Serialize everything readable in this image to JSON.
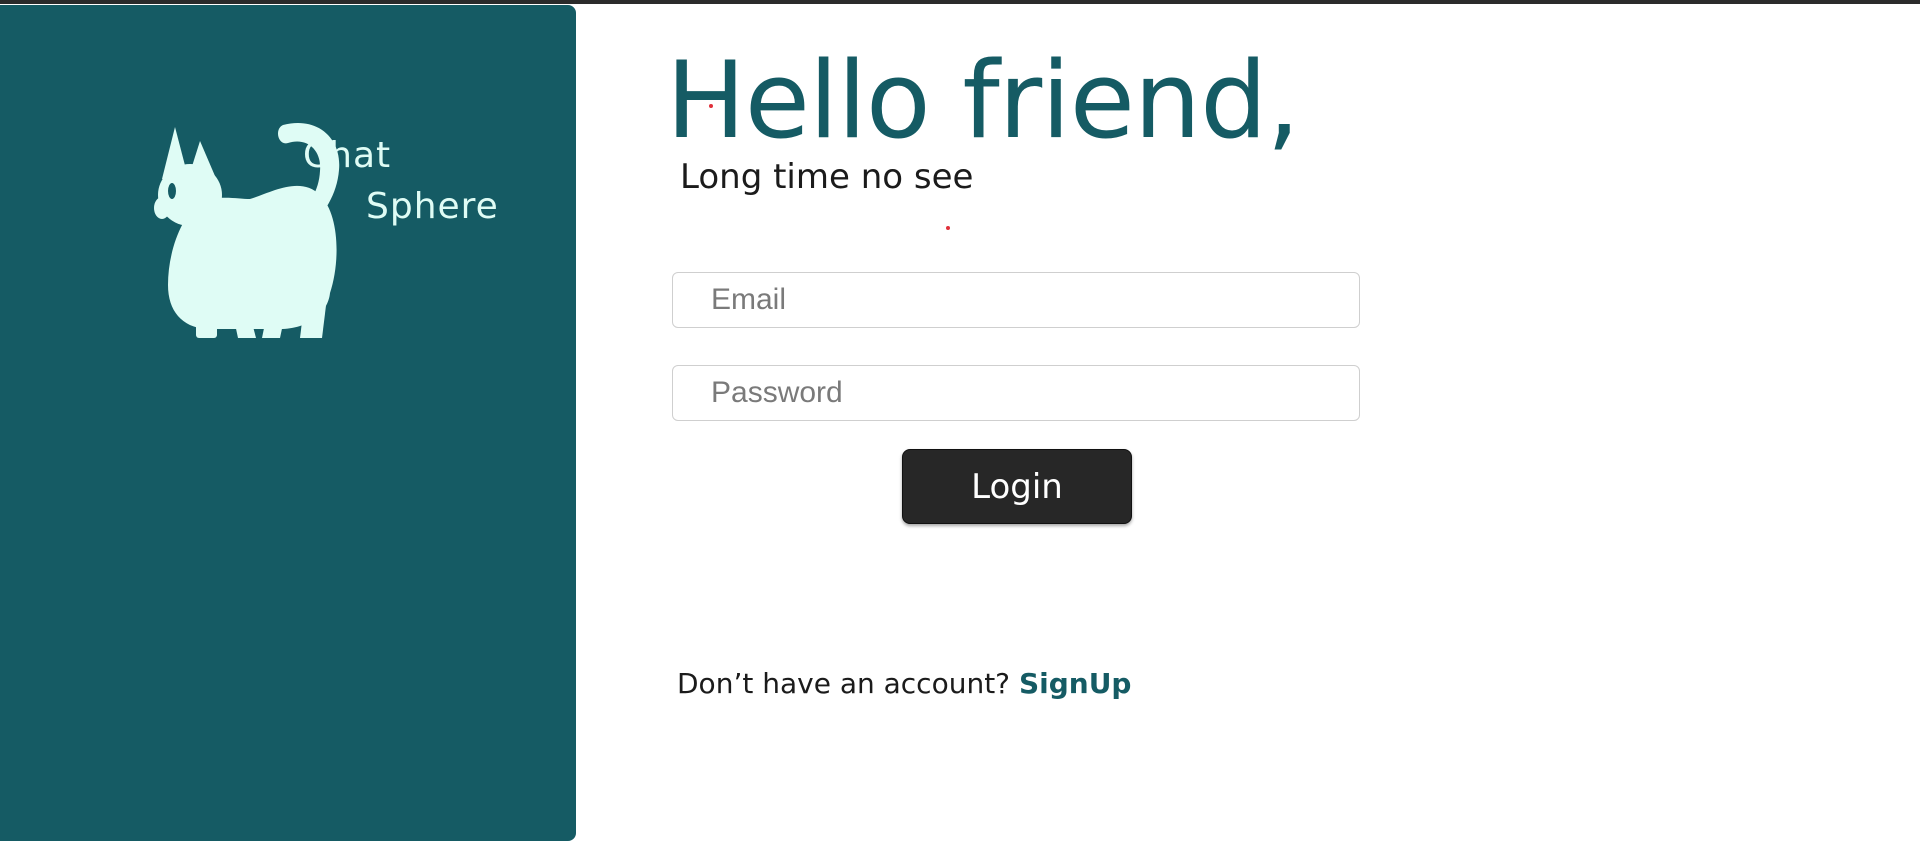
{
  "brand": {
    "name_line1": "Chat",
    "name_line2": "Sphere",
    "logo_icon": "cat-icon",
    "panel_color": "#155b64",
    "logo_color": "#dffcf5"
  },
  "login": {
    "greeting": "Hello friend,",
    "subgreeting": "Long time no see",
    "email_placeholder": "Email",
    "email_value": "",
    "password_placeholder": "Password",
    "password_value": "",
    "login_label": "Login",
    "signup_prompt": "Don’t have an account?",
    "signup_label": "SignUp",
    "heading_color": "#155b64",
    "text_color": "#1b1b1b",
    "button_color": "#272727",
    "button_text_color": "#ffffff",
    "dot_color": "#e0303b"
  }
}
